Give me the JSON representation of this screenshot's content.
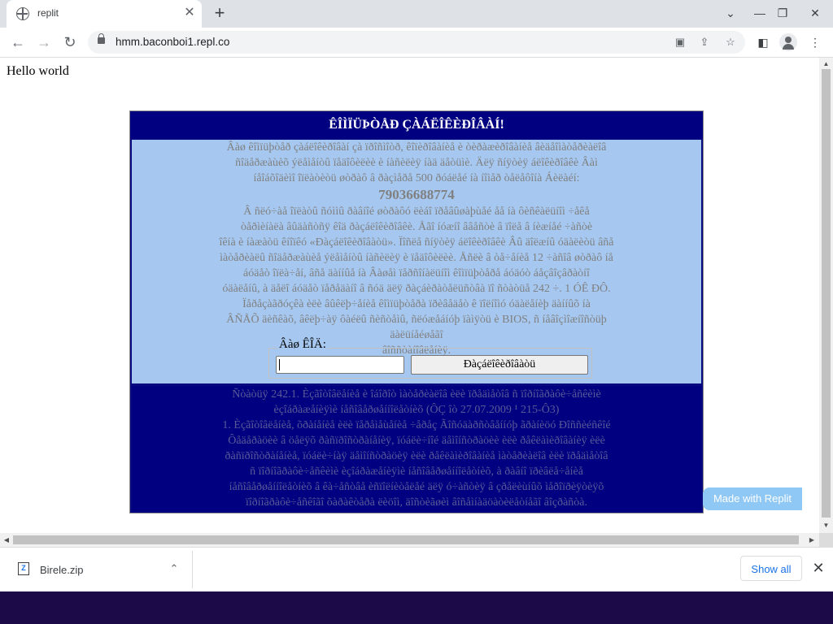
{
  "browser": {
    "tab_title": "replit",
    "tab_close": "✕",
    "new_tab": "+",
    "window_controls": [
      "⌄",
      "—",
      "❐",
      "✕"
    ],
    "url": "hmm.baconboi1.repl.co",
    "nav": {
      "back": "←",
      "forward": "→",
      "reload": "↻"
    }
  },
  "page": {
    "hello": "Hello world",
    "header": "ÊÎÌÏÜÞÒÅÐ ÇÀÁËÎÊÈÐÎÂÀÍ!",
    "body_lines_1": [
      "Âàø êîìïüþòåð çàáëîêèðîâàí çà ïðîñìîòð, êîïèðîâàíèå è òèðàæèðîâàíèå âèäåîìàòåðèàëîâ",
      "ñîäåðæàùèõ ýëåìåíòû ïåäîôèëèè è íàñèëèÿ íàä äåòüìè. Äëÿ ñíÿòèÿ áëîêèðîâêè Âàì",
      "íåîáõîäèìî îïëàòèòü øòðàô â ðàçìåðå 500 ðóáëåé íà íîìåð òåëåôîíà Áèëàéí:"
    ],
    "phone": "79036688774",
    "body_lines_2": [
      "Â ñëó÷àå îïëàòû ñóììû ðàâíîé øòðàôó ëèáî ïðåâûøàþùåé åå íà ôèñêàëüíîì ÷åêå",
      "òåðìèíàëà âûäàñòñÿ êîä ðàçáëîêèðîâêè. Åãî íóæíî ââåñòè â ïîëå â íèæíåé ÷àñòè",
      "îêíà è íàæàòü êíîïêó «Ðàçáëîêèðîâàòü». Ïîñëå ñíÿòèÿ áëîêèðîâêè Âû äîëæíû óäàëèòü âñå",
      "ìàòåðèàëû ñîäåðæàùèå ýëåìåíòû íàñèëèÿ è ïåäîôèëèè. Åñëè â òå÷åíèå 12 ÷àñîâ øòðàô íå",
      "áóäåò îïëà÷åí, âñå äàííûå íà Âàøåì ïåðñîíàëüíîì êîìïüþòåðå áóäóò áåçâîçâðàòíî",
      "óäàëåíû, à äåëî áóäåò ïåðåäàíî â ñóä äëÿ ðàçáèðàòåëüñòâà ïî ñòàòüå 242 ÷. 1 ÓÊ ÐÔ.",
      "Ïåðåçàãðóçêà èëè âûêëþ÷åíèå êîìïüþòåðà ïðèâåäåò ê ïîëíîìó óäàëåíèþ äàííûõ íà",
      "ÂÑÅÕ äèñêàõ, âêëþ÷àÿ ôàéëû ñèñòåìû, ñëóæåáíóþ ïàìÿòü è BIOS, ñ íåâîçìîæíîñòüþ äàëüíåéøåãî",
      "âîññòàíîâëåíèÿ."
    ],
    "form": {
      "legend": "Âàø ÊÎÄ:",
      "input_value": "",
      "button": "Ðàçáëîêèðîâàòü"
    },
    "footer_lines": [
      "Ñòàòüÿ 242.1. Èçãîòîâëåíèå è îáîðîò ìàòåðèàëîâ èëè ïðåäìåòîâ ñ ïîðíîãðàôè÷åñêèìè",
      "èçîáðàæåíèÿìè íåñîâåðøåííîëåòíèõ (ÔÇ îò 27.07.2009 ¹ 215-Ô3)",
      "1. Èçãîòîâëåíèå, õðàíåíèå èëè ïåðåìåùåíèå ÷åðåç Ãîñóäàðñòâåííóþ ãðàíèöó Ðîññèéñêîé",
      "Ôåäåðàöèè â öåëÿõ ðàñïðîñòðàíåíèÿ, ïóáëè÷íîé äåìîíñòðàöèè èëè ðåêëàìèðîâàíèÿ èëè",
      "ðàñïðîñòðàíåíèå, ïóáëè÷íàÿ äåìîíñòðàöèÿ èëè ðåêëàìèðîâàíèå ìàòåðèàëîâ èëè ïðåäìåòîâ",
      "ñ ïîðíîãðàôè÷åñêèìè èçîáðàæåíèÿìè íåñîâåðøåííîëåòíèõ, à ðàâíî ïðèâëå÷åíèå",
      "íåñîâåðøåííîëåòíèõ â êà÷åñòâå èñïîëíèòåëåé äëÿ ó÷àñòèÿ â çðåëèùíûõ ìåðîïðèÿòèÿõ",
      "ïîðíîãðàôè÷åñêîãî õàðàêòåðà ëèöîì, äîñòèãøèì âîñåìíàäöàòèëåòíåãî âîçðàñòà."
    ],
    "replit_badge": "Made with Replit"
  },
  "downloads": {
    "file_name": "Birele.zip",
    "show_all": "Show all"
  },
  "colors": {
    "header_bg": "#000080",
    "body_bg": "#a6c8f0",
    "footer_bg": "#000080"
  }
}
